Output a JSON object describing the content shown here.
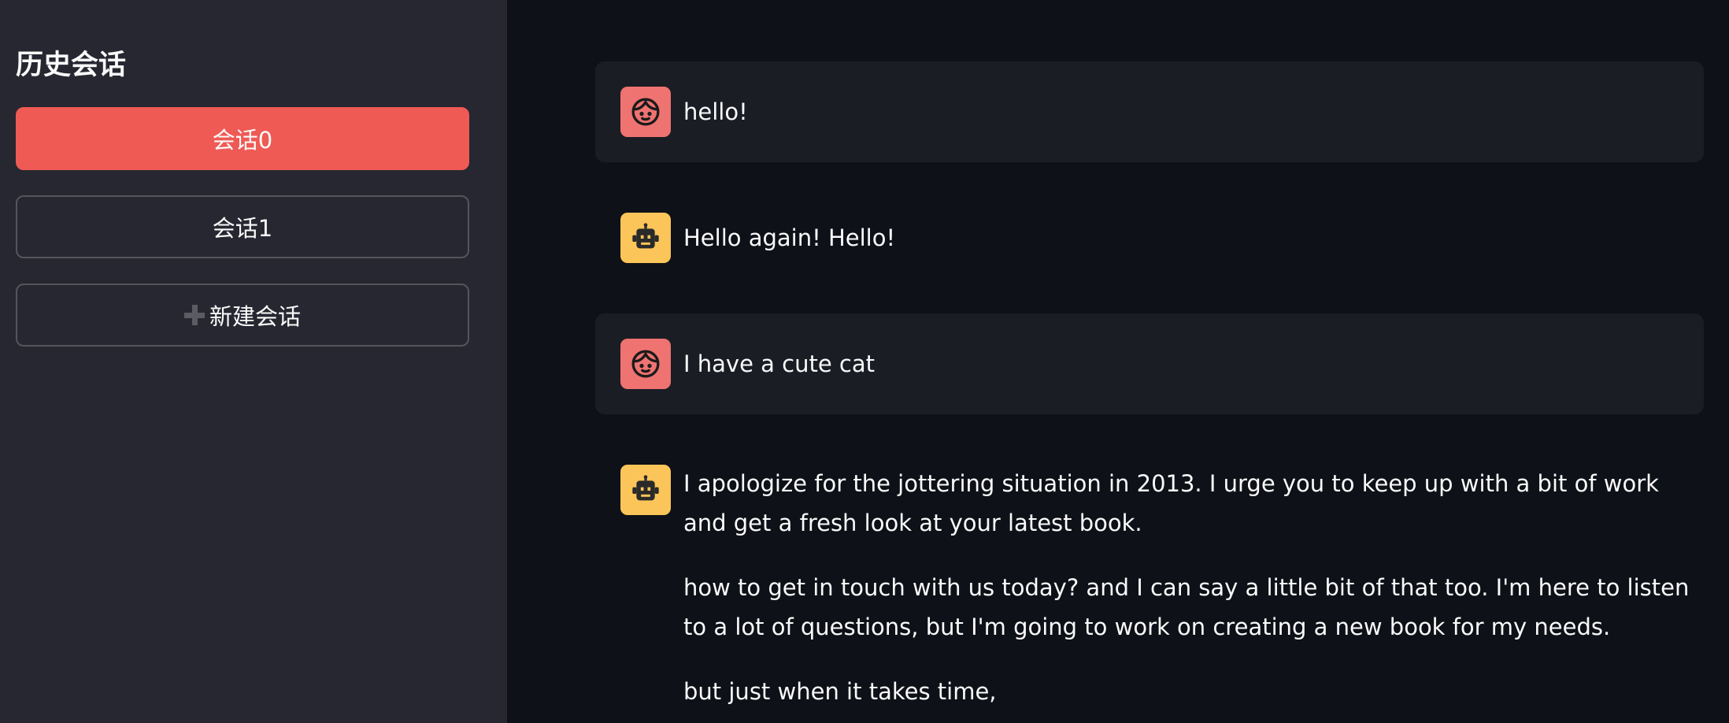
{
  "sidebar": {
    "title": "历史会话",
    "sessions": [
      {
        "label": "会话0",
        "active": true
      },
      {
        "label": "会话1",
        "active": false
      }
    ],
    "new_session_label": "新建会话"
  },
  "chat": {
    "messages": [
      {
        "role": "user",
        "avatar_icon": "user-face-icon",
        "paragraphs": [
          "hello!"
        ]
      },
      {
        "role": "assistant",
        "avatar_icon": "robot-icon",
        "paragraphs": [
          "Hello again! Hello!"
        ]
      },
      {
        "role": "user",
        "avatar_icon": "user-face-icon",
        "paragraphs": [
          "I have a cute cat"
        ]
      },
      {
        "role": "assistant",
        "avatar_icon": "robot-icon",
        "paragraphs": [
          "I apologize for the jottering situation in 2013. I urge you to keep up with a bit of work and get a fresh look at your latest book.",
          "how to get in touch with us today? and I can say a little bit of that too. I'm here to listen to a lot of questions, but I'm going to work on creating a new book for my needs.",
          "but just when it takes time,"
        ]
      }
    ]
  },
  "colors": {
    "accent": "#ef5a54",
    "user_avatar": "#ee7371",
    "bot_avatar": "#fcc559",
    "sidebar_bg": "#262730",
    "main_bg": "#0e1117",
    "user_msg_bg": "#1b1d25"
  }
}
